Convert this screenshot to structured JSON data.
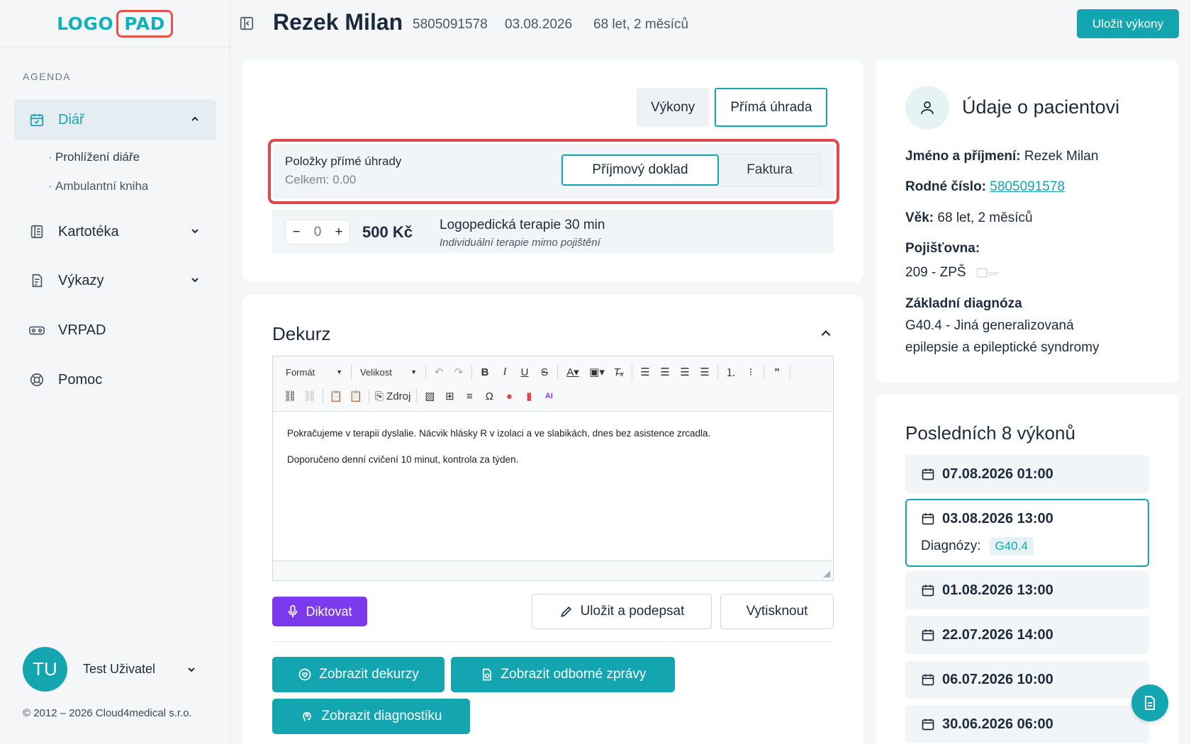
{
  "logo": {
    "part1": "LOGO",
    "part2": "PAD"
  },
  "sidebar": {
    "section_label": "AGENDA",
    "items": [
      {
        "label": "Diář",
        "icon": "calendar-check-icon",
        "expanded": true
      },
      {
        "label": "Kartotéka",
        "icon": "book-icon"
      },
      {
        "label": "Výkazy",
        "icon": "report-icon"
      },
      {
        "label": "VRPAD",
        "icon": "vr-headset-icon"
      },
      {
        "label": "Pomoc",
        "icon": "lifebuoy-icon"
      }
    ],
    "subitems": [
      "Prohlížení diáře",
      "Ambulantní kniha"
    ],
    "user": {
      "initials": "TU",
      "name": "Test Uživatel"
    },
    "copyright": "© 2012 – 2026 Cloud4medical s.r.o."
  },
  "header": {
    "patient_name": "Rezek Milan",
    "birth_number": "5805091578",
    "date": "03.08.2026",
    "age": "68 let, 2 měsíců",
    "save_button": "Uložit výkony"
  },
  "payment": {
    "tabs": [
      "Výkony",
      "Přímá úhrada"
    ],
    "active_tab": "Přímá úhrada",
    "title": "Položky přímé úhrady",
    "total": "Celkem: 0.00",
    "doc_types": [
      "Příjmový doklad",
      "Faktura"
    ],
    "active_doc_type": "Příjmový doklad",
    "item": {
      "qty_minus": "−",
      "qty": "0",
      "qty_plus": "+",
      "price": "500 Kč",
      "name": "Logopedická terapie 30 min",
      "desc": "Individuální terapie mimo pojištění"
    }
  },
  "dekurz": {
    "title": "Dekurz",
    "toolbar": {
      "format": "Formát",
      "size": "Velikost",
      "source": "Zdroj"
    },
    "text": [
      "Pokračujeme v terapii dyslalie. Nácvik hlásky R v izolaci a ve slabikách, dnes bez asistence zrcadla.",
      "Doporučeno denní cvičení 10 minut, kontrola za týden."
    ],
    "dictate": "Diktovat",
    "save_sign": "Uložit a podepsat",
    "print": "Vytisknout",
    "show_dekurzy": "Zobrazit dekurzy",
    "show_reports": "Zobrazit odborné zprávy",
    "show_diag": "Zobrazit diagnostiku"
  },
  "patient_info": {
    "title": "Údaje o pacientovi",
    "name_label": "Jméno a příjmení:",
    "name_value": "Rezek Milan",
    "rc_label": "Rodné číslo:",
    "rc_value": "5805091578",
    "age_label": "Věk:",
    "age_value": "68 let, 2 měsíců",
    "ins_label": "Pojišťovna:",
    "ins_value": "209 - ZPŠ",
    "diag_label": "Základní diagnóza",
    "diag_line1": "G40.4 - Jiná generalizovaná",
    "diag_line2": "epilepsie a epileptické syndromy"
  },
  "history": {
    "title": "Posledních 8 výkonů",
    "items": [
      "07.08.2026 01:00",
      "03.08.2026 13:00",
      "01.08.2026 13:00",
      "22.07.2026 14:00",
      "06.07.2026 10:00",
      "30.06.2026 06:00"
    ],
    "selected_diag_label": "Diagnózy:",
    "selected_diag": "G40.4"
  },
  "colors": {
    "accent": "#14a6b0",
    "highlight": "#e0474b",
    "purple": "#7c3aed"
  }
}
